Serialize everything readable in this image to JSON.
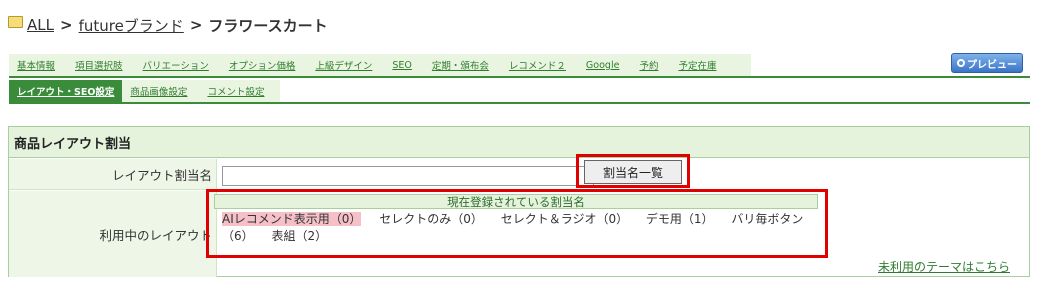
{
  "breadcrumb": {
    "items": [
      "ALL",
      "futureブランド"
    ],
    "separator": ">",
    "current": "フラワースカート"
  },
  "preview_button": "プレビュー",
  "tabs_row1": [
    "基本情報",
    "項目選択肢",
    "バリエーション",
    "オプション価格",
    "上級デザイン",
    "SEO",
    "定期・頒布会",
    "レコメンド２",
    "Google",
    "予約",
    "予定在庫"
  ],
  "tabs_row2": {
    "active": "レイアウト・SEO設定",
    "others": [
      "商品画像設定",
      "コメント設定"
    ]
  },
  "panel": {
    "title": "商品レイアウト割当",
    "layout_name_label": "レイアウト割当名",
    "layout_name_value": "",
    "list_button": "割当名一覧",
    "in_use_label": "利用中のレイアウト",
    "theme_header": "現在登録されている割当名",
    "themes": [
      {
        "name": "AIレコメンド表示用（0）",
        "highlight": true
      },
      {
        "name": "セレクトのみ（0）",
        "highlight": false
      },
      {
        "name": "セレクト＆ラジオ（0）",
        "highlight": false
      },
      {
        "name": "デモ用（1）",
        "highlight": false
      },
      {
        "name": "バリ毎ボタン（6）",
        "highlight": false
      },
      {
        "name": "表組（2）",
        "highlight": false
      }
    ],
    "unused_link": "未利用のテーマはこちら"
  },
  "colors": {
    "accent_green": "#3a8b3a",
    "highlight_red": "#e00000",
    "tab_bg": "#eaf5e1"
  }
}
